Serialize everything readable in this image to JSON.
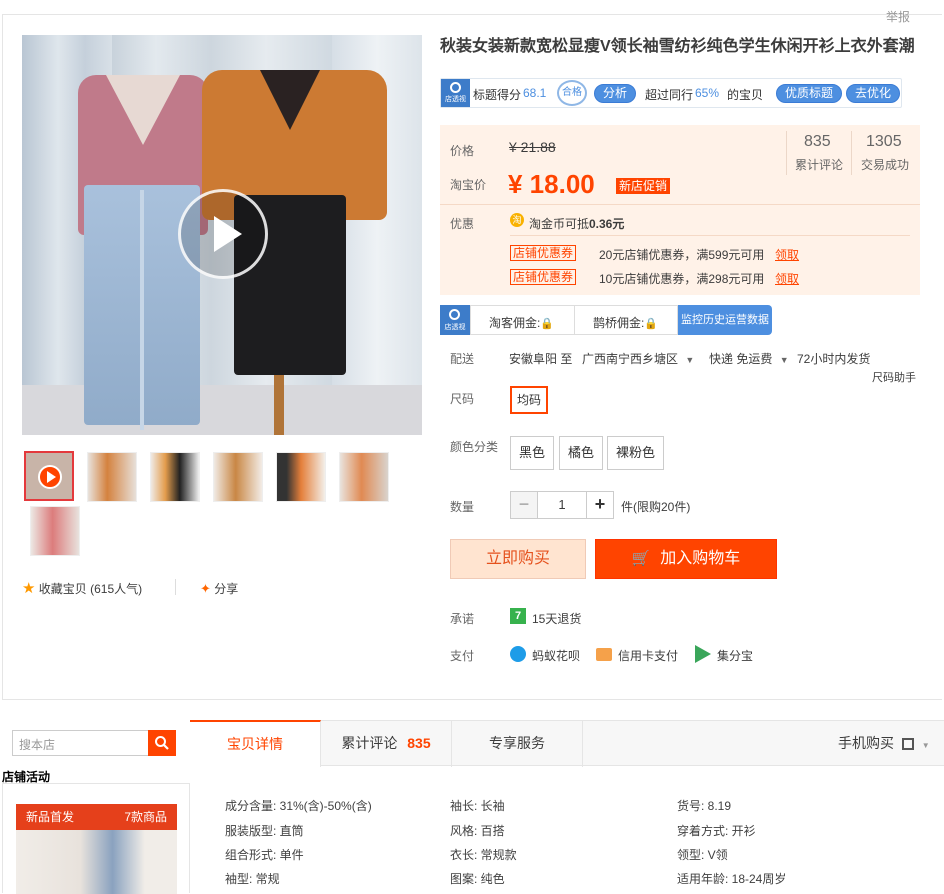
{
  "report_label": "举报",
  "title": "秋装女装新款宽松显瘦V领长袖雪纺衫纯色学生休闲开衫上衣外套潮",
  "ztc": {
    "badge": "店透视",
    "score_label": "标题得分",
    "score_value": "68.1",
    "pass_stamp": "合格",
    "analyze": "分析",
    "peer_prefix": "超过同行",
    "peer_value": "65%",
    "peer_suffix": "的宝贝",
    "optimize": "优质标题",
    "go_optimize": "去优化"
  },
  "price": {
    "label": "价格",
    "original": "¥ 21.88",
    "taobao_label": "淘宝价",
    "current": "¥ 18.00",
    "promo_tag": "新店促销",
    "reviews_count": "835",
    "reviews_label": "累计评论",
    "sales_count": "1305",
    "sales_label": "交易成功",
    "discount_label": "优惠",
    "coin_text": "淘金币可抵",
    "coin_value": "0.36元",
    "coupons": [
      {
        "tag": "店铺优惠券",
        "text": "20元店铺优惠券，满599元可用",
        "action": "领取"
      },
      {
        "tag": "店铺优惠券",
        "text": "10元店铺优惠券，满298元可用",
        "action": "领取"
      }
    ]
  },
  "commission": {
    "badge": "店透视",
    "taoke": "淘客佣金:",
    "queqiao": "鹊桥佣金:",
    "tab_active": "监控历史运营数据"
  },
  "delivery": {
    "label": "配送",
    "from": "安徽阜阳 至",
    "to": "广西南宁西乡塘区",
    "method": "快递 免运费",
    "ship_time": "72小时内发货",
    "size_helper": "尺码助手"
  },
  "size": {
    "label": "尺码",
    "options": [
      "均码"
    ]
  },
  "color": {
    "label": "颜色分类",
    "options": [
      "黑色",
      "橘色",
      "裸粉色"
    ]
  },
  "quantity": {
    "label": "数量",
    "value": "1",
    "unit": "件(限购20件)"
  },
  "buy_now": "立即购买",
  "add_cart": "加入购物车",
  "promise": {
    "label": "承诺",
    "text": "15天退货"
  },
  "payment": {
    "label": "支付",
    "methods": [
      "蚂蚁花呗",
      "信用卡支付",
      "集分宝"
    ]
  },
  "favorite": "收藏宝贝 (615人气)",
  "share": "分享",
  "search": {
    "placeholder": "搜本店"
  },
  "shop_activity": "店铺活动",
  "new_arrival": {
    "title": "新品首发",
    "count": "7款商品"
  },
  "tabs": [
    {
      "label": "宝贝详情"
    },
    {
      "label": "累计评论",
      "count": "835"
    },
    {
      "label": "专享服务"
    }
  ],
  "mobile_buy": "手机购买",
  "attributes": [
    [
      "成分含量: 31%(含)-50%(含)",
      "袖长: 长袖",
      "货号: 8.19"
    ],
    [
      "服装版型: 直筒",
      "风格: 百搭",
      "穿着方式: 开衫"
    ],
    [
      "组合形式: 单件",
      "衣长: 常规款",
      "领型: V领"
    ],
    [
      "袖型: 常规",
      "图案: 纯色",
      "适用年龄: 18-24周岁"
    ]
  ],
  "colors": {
    "accent": "#ff4400",
    "price": "#f40",
    "ztc_blue": "#4d8fe0"
  }
}
